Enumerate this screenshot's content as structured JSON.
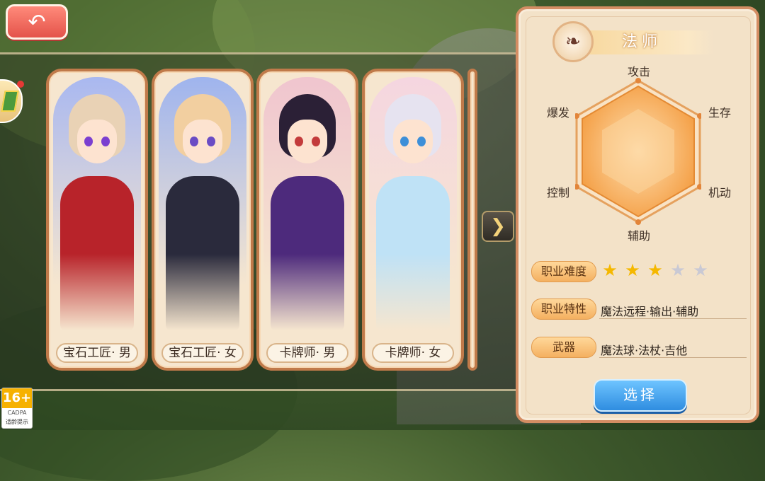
{
  "nav": {
    "back_icon": "back-arrow-icon",
    "next_icon": "chevron-right-icon"
  },
  "cards": [
    {
      "label": "宝石工匠· 男",
      "hair": "#e9d2b5",
      "eye": "#7b3fd0",
      "outfit": "#b8232a",
      "sky": "#a9b8f0"
    },
    {
      "label": "宝石工匠· 女",
      "hair": "#f2cfa0",
      "eye": "#6a4cc4",
      "outfit": "#2a2a3c",
      "sky": "#9fb4ee"
    },
    {
      "label": "卡牌师· 男",
      "hair": "#2b2036",
      "eye": "#c33b3b",
      "outfit": "#4d2a7c",
      "sky": "#f0c5cf"
    },
    {
      "label": "卡牌师· 女",
      "hair": "#e6e3f0",
      "eye": "#3d8fd8",
      "outfit": "#bfe2f6",
      "sky": "#f5d6e0"
    }
  ],
  "panel": {
    "class_name": "法师",
    "class_icon": "magic-staff-icon",
    "radar": {
      "attack": "攻击",
      "survival": "生存",
      "mobility": "机动",
      "support": "辅助",
      "control": "控制",
      "burst": "爆发"
    },
    "difficulty_label": "职业难度",
    "difficulty": 3,
    "difficulty_max": 5,
    "trait_label": "职业特性",
    "trait_value": "魔法远程·输出·辅助",
    "weapon_label": "武器",
    "weapon_value": "魔法球·法杖·吉他"
  },
  "select_label": "选择",
  "age_badge": {
    "rating": "16+",
    "org": "CADPA",
    "tip": "适龄提示"
  },
  "colors": {
    "star_on": "#f5b800",
    "star_off": "#c9c9d4",
    "radar_fill": "#f6a94f"
  }
}
